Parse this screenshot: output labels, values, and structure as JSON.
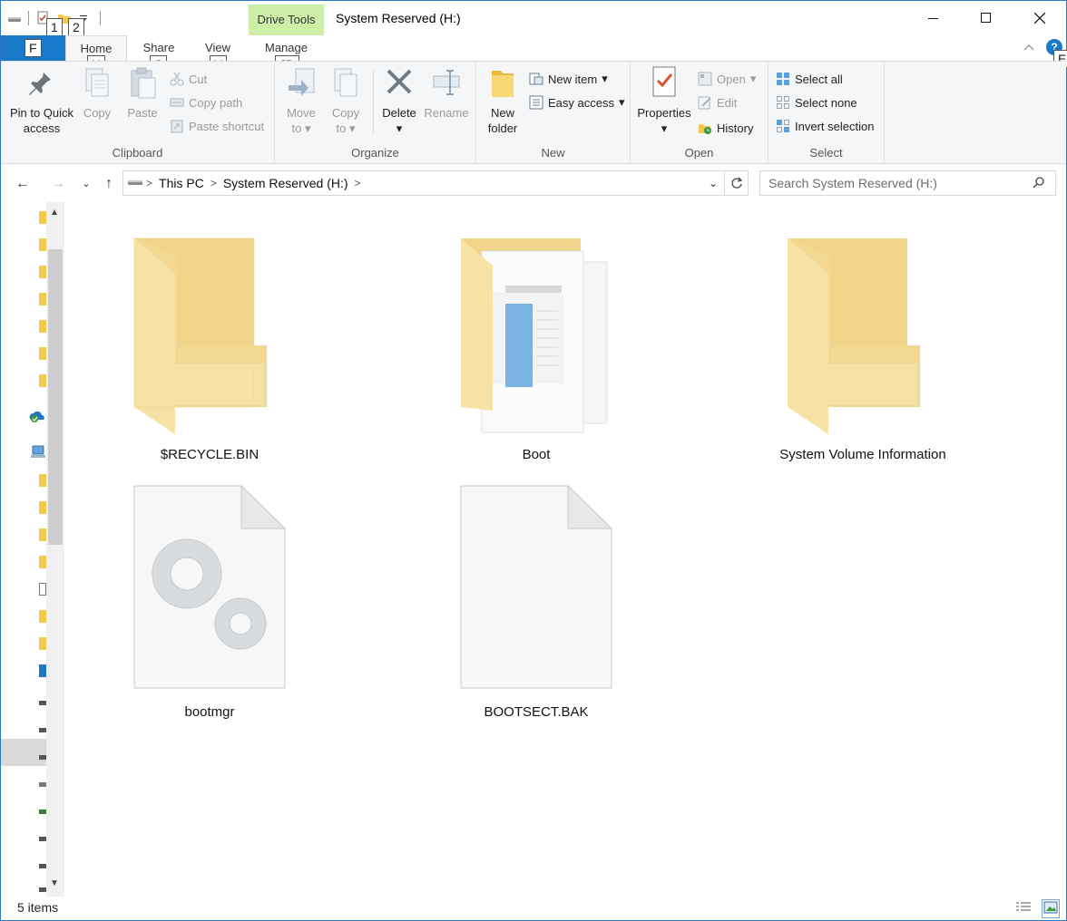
{
  "window": {
    "title": "System Reserved (H:)",
    "context_tab": "Drive Tools"
  },
  "quick_access_toolbar": {
    "keytips": [
      "1",
      "2"
    ]
  },
  "tabs": [
    {
      "label": "Home",
      "keytip": "H",
      "active": true
    },
    {
      "label": "Share",
      "keytip": "S"
    },
    {
      "label": "View",
      "keytip": "V"
    },
    {
      "label": "Manage",
      "keytip": "JD"
    }
  ],
  "file_tab": {
    "keytip": "F"
  },
  "help_keytip": "E",
  "ribbon": {
    "clipboard": {
      "label": "Clipboard",
      "pin": "Pin to Quick access",
      "pin_line1": "Pin to Quick",
      "pin_line2": "access",
      "copy": "Copy",
      "paste": "Paste",
      "cut": "Cut",
      "copy_path": "Copy path",
      "paste_shortcut": "Paste shortcut"
    },
    "organize": {
      "label": "Organize",
      "move_to_1": "Move",
      "move_to_2": "to",
      "copy_to_1": "Copy",
      "copy_to_2": "to",
      "delete": "Delete",
      "rename": "Rename"
    },
    "new": {
      "label": "New",
      "new_folder_1": "New",
      "new_folder_2": "folder",
      "new_item": "New item",
      "easy_access": "Easy access"
    },
    "open": {
      "label": "Open",
      "properties": "Properties",
      "open": "Open",
      "edit": "Edit",
      "history": "History"
    },
    "select": {
      "label": "Select",
      "select_all": "Select all",
      "select_none": "Select none",
      "invert_selection": "Invert selection"
    }
  },
  "address": {
    "crumbs": [
      "This PC",
      "System Reserved (H:)"
    ]
  },
  "search": {
    "placeholder": "Search System Reserved (H:)"
  },
  "items": [
    {
      "name": "$RECYCLE.BIN",
      "type": "folder"
    },
    {
      "name": "Boot",
      "type": "folder-with-docs"
    },
    {
      "name": "System Volume Information",
      "type": "folder"
    },
    {
      "name": "bootmgr",
      "type": "system-file"
    },
    {
      "name": "BOOTSECT.BAK",
      "type": "blank-file"
    }
  ],
  "status": {
    "count": "5 items"
  },
  "colors": {
    "accent": "#1979ca",
    "context_tab": "#cdeea6",
    "folder": "#f8dc8c"
  }
}
